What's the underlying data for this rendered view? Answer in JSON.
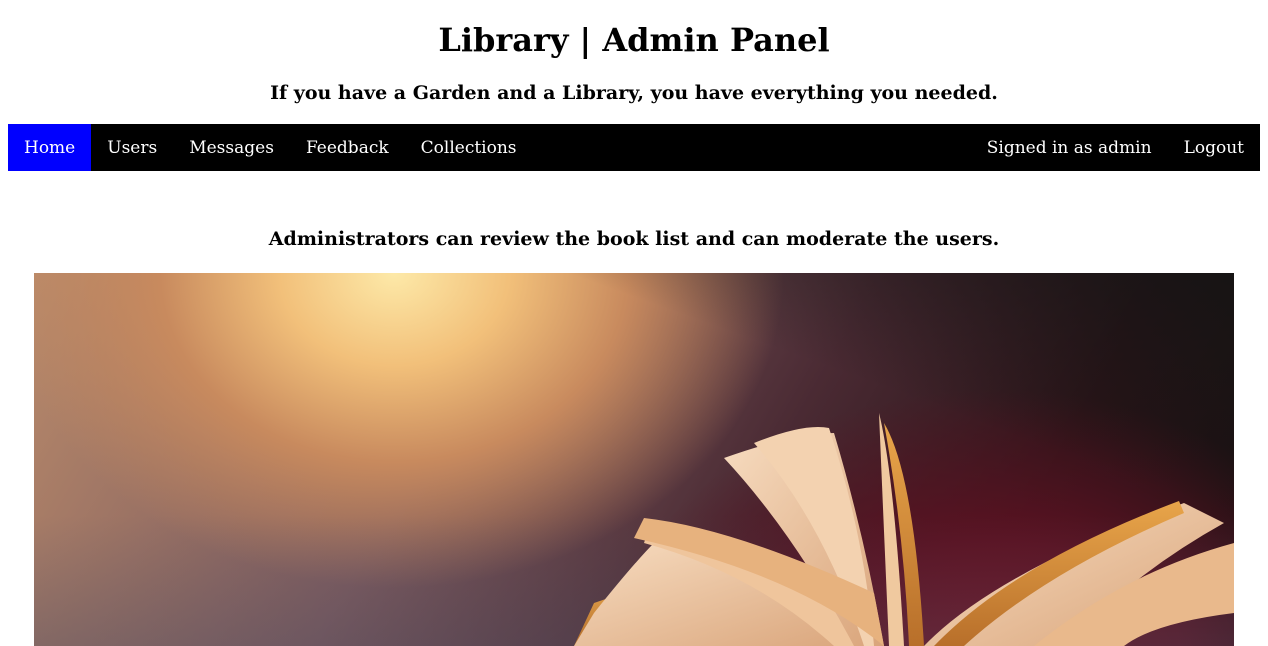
{
  "header": {
    "title": "Library | Admin Panel",
    "tagline": "If you have a Garden and a Library, you have everything you needed."
  },
  "nav": {
    "items": [
      {
        "label": "Home",
        "active": true
      },
      {
        "label": "Users",
        "active": false
      },
      {
        "label": "Messages",
        "active": false
      },
      {
        "label": "Feedback",
        "active": false
      },
      {
        "label": "Collections",
        "active": false
      }
    ],
    "signed_in": "Signed in as admin",
    "logout": "Logout"
  },
  "main": {
    "intro": "Administrators can review the book list and can moderate the users."
  },
  "colors": {
    "nav_background": "#000000",
    "nav_active": "#0000ff",
    "nav_text": "#ffffff"
  }
}
